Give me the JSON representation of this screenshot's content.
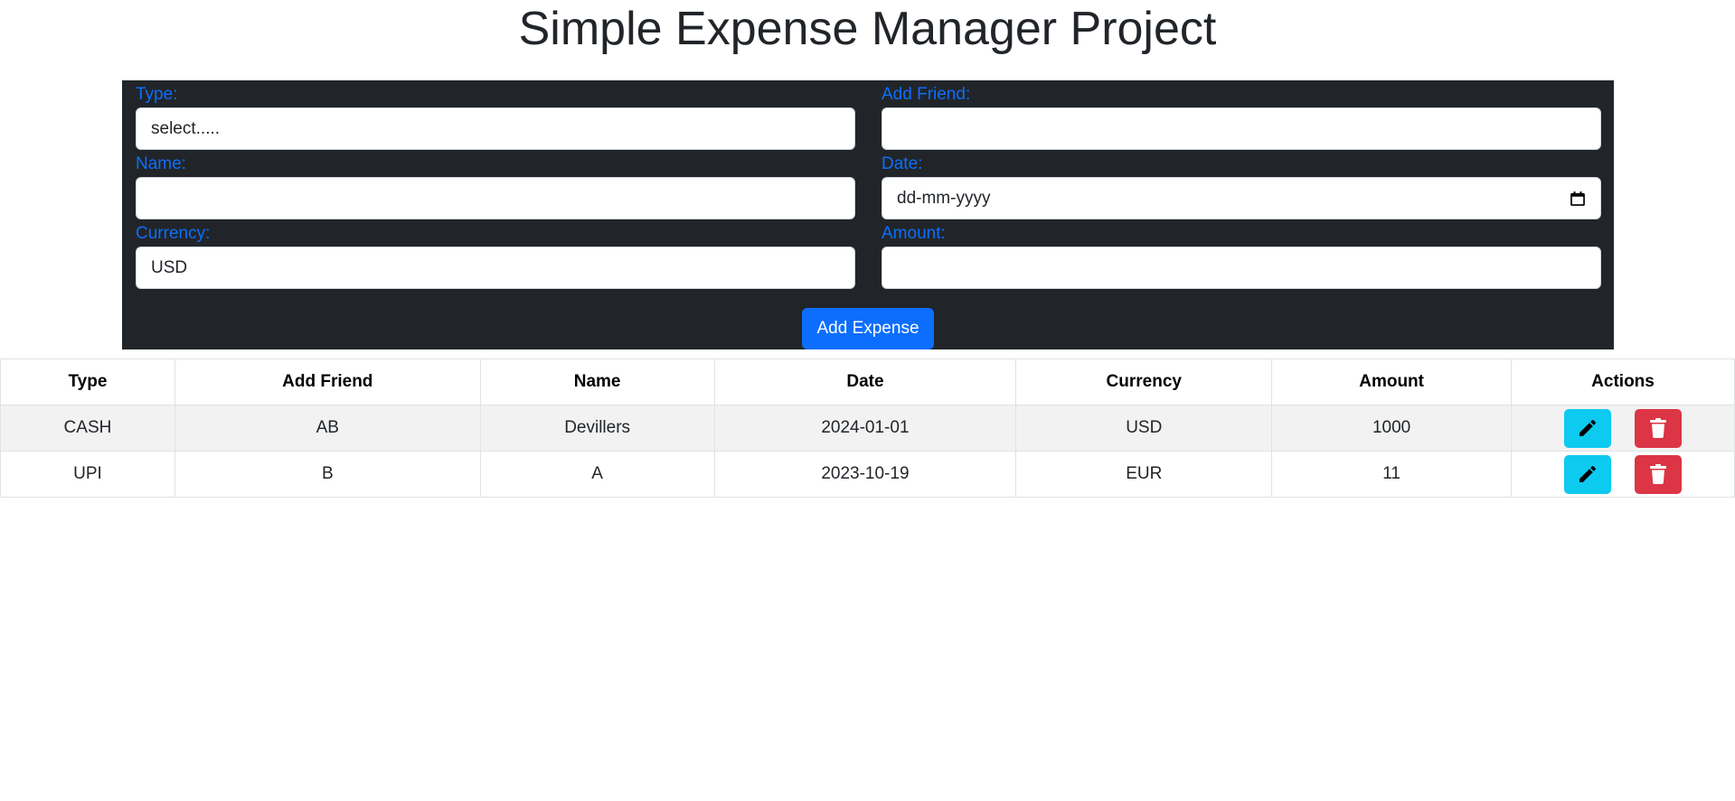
{
  "title": "Simple Expense Manager Project",
  "form": {
    "type": {
      "label": "Type:",
      "value": "select....."
    },
    "add_friend": {
      "label": "Add Friend:",
      "value": ""
    },
    "name": {
      "label": "Name:",
      "value": ""
    },
    "date": {
      "label": "Date:",
      "placeholder": "dd-mm-yyyy"
    },
    "currency": {
      "label": "Currency:",
      "value": "USD"
    },
    "amount": {
      "label": "Amount:",
      "value": ""
    },
    "submit_label": "Add Expense"
  },
  "table": {
    "headers": [
      "Type",
      "Add Friend",
      "Name",
      "Date",
      "Currency",
      "Amount",
      "Actions"
    ],
    "rows": [
      [
        "CASH",
        "AB",
        "Devillers",
        "2024-01-01",
        "USD",
        "1000"
      ],
      [
        "UPI",
        "B",
        "A",
        "2023-10-19",
        "EUR",
        "11"
      ]
    ]
  },
  "colors": {
    "primary": "#0d6efd",
    "panel": "#212529",
    "edit": "#0dcaf0",
    "delete": "#dc3545"
  },
  "icons": {
    "edit": "pencil-icon",
    "delete": "trash-icon",
    "date": "calendar-icon"
  }
}
